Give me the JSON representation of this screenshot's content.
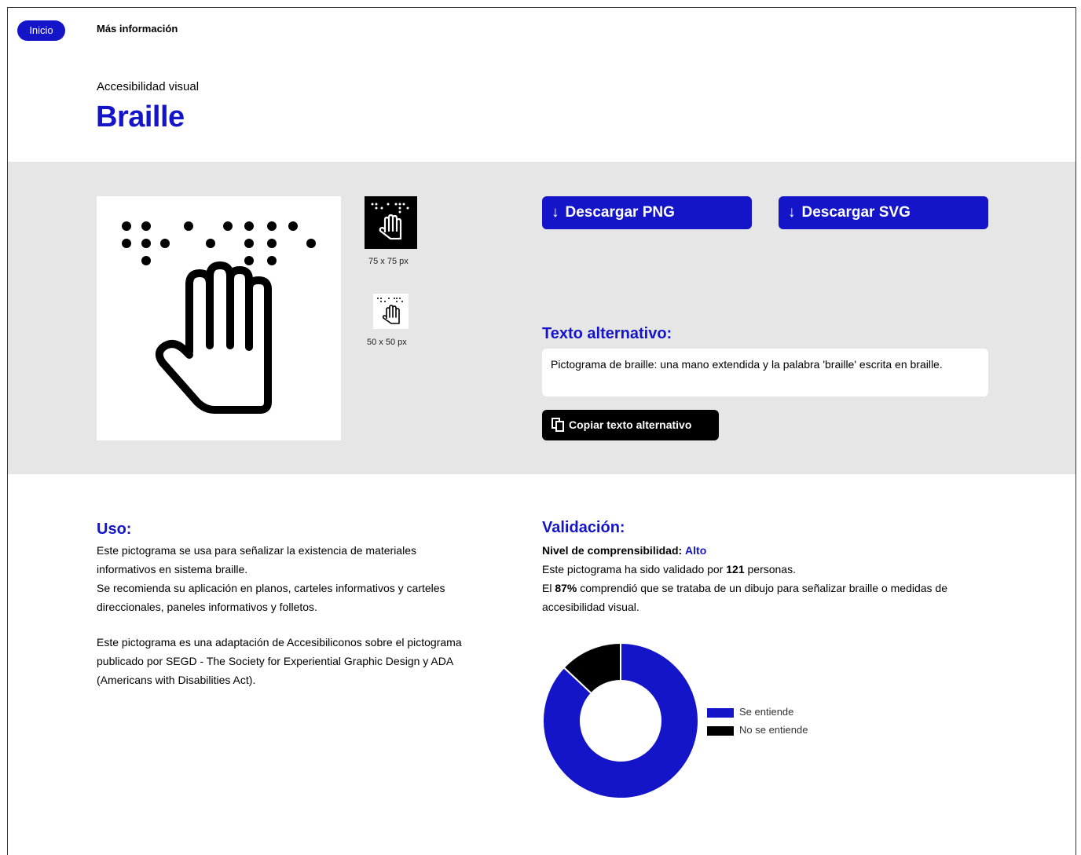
{
  "nav": {
    "home_label": "Inicio",
    "more_label": "Más información"
  },
  "header": {
    "breadcrumb": "Accesibilidad visual",
    "title": "Braille"
  },
  "previews": {
    "size_75": "75 x 75 px",
    "size_50": "50 x 50 px"
  },
  "downloads": {
    "png_label": "Descargar PNG",
    "svg_label": "Descargar SVG",
    "arrow": "↓"
  },
  "alt_text": {
    "heading": "Texto alternativo:",
    "text": "Pictograma de braille: una mano extendida y la palabra 'braille' escrita en braille.",
    "copy_label": "Copiar texto alternativo"
  },
  "uso": {
    "heading": "Uso:",
    "p1": "Este pictograma se usa para señalizar la existencia de materiales informativos en sistema braille.",
    "p2": "Se recomienda su aplicación en planos, carteles informativos y carteles direccionales, paneles informativos y folletos.",
    "p3": "Este pictograma es una adaptación de Accesibiliconos sobre el pictograma publicado por SEGD - The Society for Experiential Graphic Design y ADA (Americans with Disabilities Act)."
  },
  "validacion": {
    "heading": "Validación:",
    "level_label": "Nivel de comprensibilidad:",
    "level_value": "Alto",
    "count_pre": "Este pictograma ha sido validado por ",
    "count": "121",
    "count_post": " personas.",
    "pct_pre": "El ",
    "pct": "87%",
    "pct_post": " comprendió que se trataba de un dibujo para señalizar braille o medidas de accesibilidad visual."
  },
  "colors": {
    "accent": "#1414c8",
    "black": "#000000",
    "band": "#e6e6e6"
  },
  "chart_data": {
    "type": "pie",
    "categories": [
      "Se entiende",
      "No se entiende"
    ],
    "values": [
      87,
      13
    ],
    "colors": [
      "#1414c8",
      "#000000"
    ],
    "legend": "right"
  }
}
